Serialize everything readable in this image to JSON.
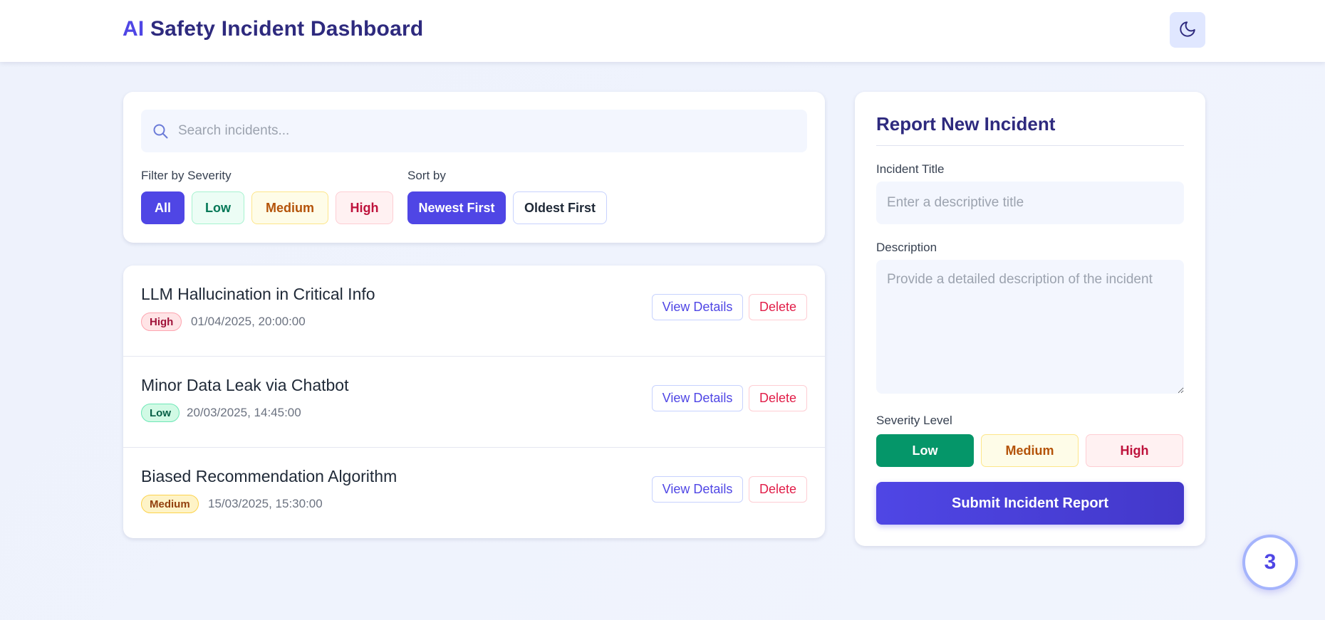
{
  "header": {
    "title_prefix": "AI",
    "title_rest": " Safety Incident Dashboard",
    "theme_icon": "moon-icon"
  },
  "filters": {
    "search_placeholder": "Search incidents...",
    "search_value": "",
    "severity_label": "Filter by Severity",
    "severity_options": [
      "All",
      "Low",
      "Medium",
      "High"
    ],
    "severity_selected": "All",
    "sort_label": "Sort by",
    "sort_options": [
      "Newest First",
      "Oldest First"
    ],
    "sort_selected": "Newest First"
  },
  "incidents": [
    {
      "title": "LLM Hallucination in Critical Info",
      "severity": "High",
      "date": "01/04/2025, 20:00:00"
    },
    {
      "title": "Minor Data Leak via Chatbot",
      "severity": "Low",
      "date": "20/03/2025, 14:45:00"
    },
    {
      "title": "Biased Recommendation Algorithm",
      "severity": "Medium",
      "date": "15/03/2025, 15:30:00"
    }
  ],
  "actions": {
    "view_label": "View Details",
    "delete_label": "Delete"
  },
  "form": {
    "title": "Report New Incident",
    "title_label": "Incident Title",
    "title_placeholder": "Enter a descriptive title",
    "title_value": "",
    "description_label": "Description",
    "description_placeholder": "Provide a detailed description of the incident",
    "description_value": "",
    "severity_label": "Severity Level",
    "severity_options": [
      "Low",
      "Medium",
      "High"
    ],
    "severity_selected": "Low",
    "submit_label": "Submit Incident Report"
  },
  "incident_count": "3",
  "colors": {
    "primary": "#4f46e5",
    "title_dark": "#2e2a7e",
    "low": "#059669",
    "medium": "#b45309",
    "high": "#be123c"
  }
}
